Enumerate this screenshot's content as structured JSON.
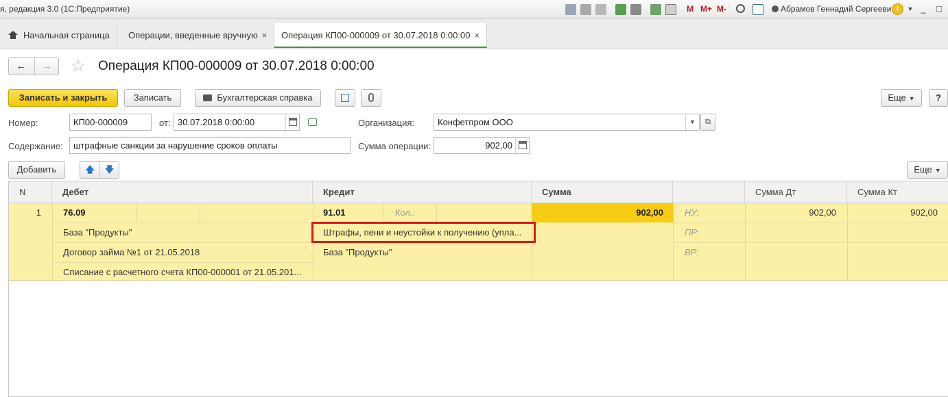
{
  "titlebar": {
    "title": "я, редакция 3.0  (1С:Предприятие)",
    "memory_buttons": [
      "M",
      "M+",
      "M-"
    ],
    "user": "Абрамов Геннадий Сергеевич",
    "window_buttons": [
      "_",
      "□"
    ]
  },
  "tabs": [
    {
      "label": "Начальная страница",
      "icon": "home-icon"
    },
    {
      "label": "Операции, введенные вручную",
      "close": "×"
    },
    {
      "label": "Операция КП00-000009 от 30.07.2018 0:00:00",
      "close": "×",
      "active": true
    }
  ],
  "header": {
    "back": "←",
    "forward": "→",
    "title": "Операция КП00-000009 от 30.07.2018 0:00:00"
  },
  "toolbar": {
    "save_close": "Записать и закрыть",
    "save": "Записать",
    "report": "Бухгалтерская справка",
    "more": "Еще",
    "help": "?"
  },
  "form": {
    "number_label": "Номер:",
    "number_value": "КП00-000009",
    "date_label": "от:",
    "date_value": "30.07.2018  0:00:00",
    "org_label": "Организация:",
    "org_value": "Конфетпром ООО",
    "content_label": "Содержание:",
    "content_value": "штрафные санкции за нарушение сроков оплаты",
    "amount_label": "Сумма операции:",
    "amount_value": "902,00"
  },
  "table_toolbar": {
    "add": "Добавить",
    "more": "Еще"
  },
  "table": {
    "columns": [
      "N",
      "Дебет",
      "Кредит",
      "Сумма",
      "",
      "Сумма Дт",
      "Сумма Кт"
    ],
    "row": {
      "n": "1",
      "debit_account": "76.09",
      "debit_subconto": [
        "База \"Продукты\"",
        "Договор займа №1 от 21.05.2018",
        "Списание с расчетного счета КП00-000001 от 21.05.201..."
      ],
      "credit_account": "91.01",
      "credit_qty_label": "Кол.:",
      "credit_subconto": [
        "Штрафы, пени и неустойки к получению (упла...",
        "База \"Продукты\""
      ],
      "sum": "902,00",
      "tax_labels": [
        "НУ:",
        "ПР:",
        "ВР:"
      ],
      "sum_dt": "902,00",
      "sum_kt": "902,00"
    }
  },
  "colors": {
    "primary_button": "#f2c600",
    "row_highlight": "#fbf0a6",
    "sum_highlight": "#f6cd12",
    "annotation_box": "#d8191b",
    "active_tab_underline": "#3a9a3a"
  }
}
